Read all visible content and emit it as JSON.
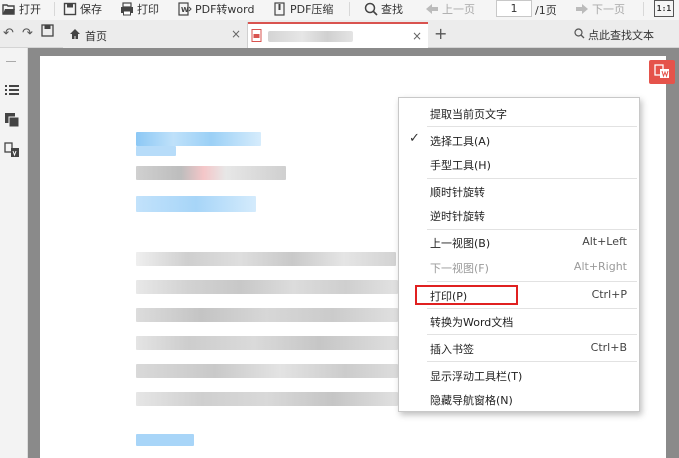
{
  "toolbar": {
    "open": "打开",
    "save": "保存",
    "print": "打印",
    "pdf_to_word": "PDF转word",
    "pdf_compress": "PDF压缩",
    "find": "查找",
    "prev_page": "上一页",
    "page_current": "1",
    "page_total": "/1页",
    "next_page": "下一页",
    "zoom_label": "1:1"
  },
  "tabs": {
    "home_label": "首页",
    "doc_close": "×",
    "home_close": "×",
    "new_tab": "+"
  },
  "find_bar": {
    "label": "点此查找文本"
  },
  "context_menu": {
    "items": [
      {
        "label": "提取当前页文字",
        "shortcut": "",
        "checked": false,
        "disabled": false
      },
      {
        "label": "选择工具(A)",
        "shortcut": "",
        "checked": true,
        "disabled": false
      },
      {
        "label": "手型工具(H)",
        "shortcut": "",
        "checked": false,
        "disabled": false
      },
      {
        "label": "顺时针旋转",
        "shortcut": "",
        "checked": false,
        "disabled": false
      },
      {
        "label": "逆时针旋转",
        "shortcut": "",
        "checked": false,
        "disabled": false
      },
      {
        "label": "上一视图(B)",
        "shortcut": "Alt+Left",
        "checked": false,
        "disabled": false
      },
      {
        "label": "下一视图(F)",
        "shortcut": "Alt+Right",
        "checked": false,
        "disabled": true
      },
      {
        "label": "打印(P)",
        "shortcut": "Ctrl+P",
        "checked": false,
        "disabled": false
      },
      {
        "label": "转换为Word文档",
        "shortcut": "",
        "checked": false,
        "disabled": false
      },
      {
        "label": "插入书签",
        "shortcut": "Ctrl+B",
        "checked": false,
        "disabled": false
      },
      {
        "label": "显示浮动工具栏(T)",
        "shortcut": "",
        "checked": false,
        "disabled": false
      },
      {
        "label": "隐藏导航窗格(N)",
        "shortcut": "",
        "checked": false,
        "disabled": false
      }
    ],
    "check_mark": "✓"
  },
  "colors": {
    "accent_red": "#e5534b",
    "highlight_red": "#e02020",
    "blur_blue": "#9fd1f7",
    "blur_gray": "#d8d8d8"
  }
}
